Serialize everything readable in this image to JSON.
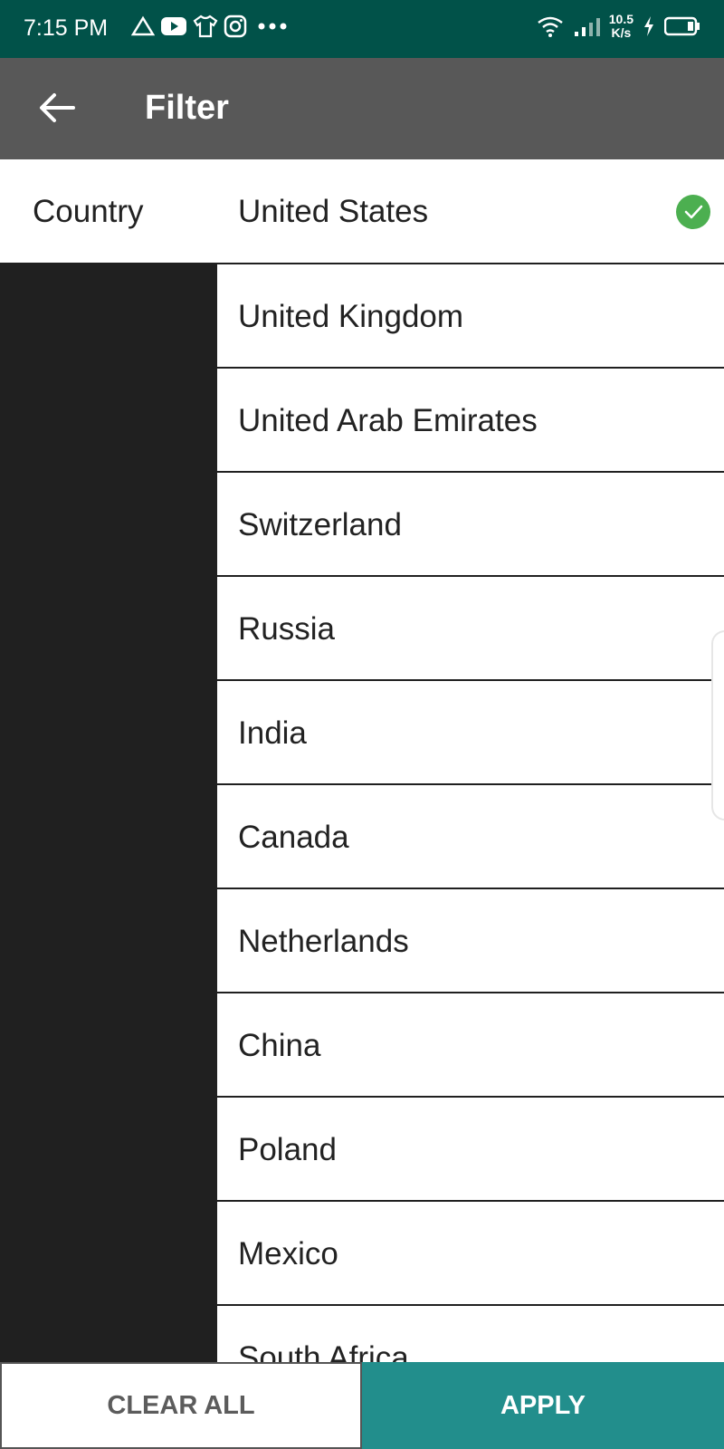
{
  "status_bar": {
    "time": "7:15 PM",
    "network_speed": "10.5",
    "network_speed_unit": "K/s",
    "icons_left": [
      "triangle-icon",
      "youtube-icon",
      "shirt-icon",
      "instagram-icon",
      "more-dots-icon"
    ],
    "icons_right": [
      "wifi-icon",
      "signal-icon",
      "charging-icon",
      "battery-icon"
    ]
  },
  "app_bar": {
    "title": "Filter"
  },
  "filter": {
    "label": "Country",
    "selected": "United States",
    "accent": "#4caf50"
  },
  "countries": [
    "United Kingdom",
    "United Arab Emirates",
    "Switzerland",
    "Russia",
    "India",
    "Canada",
    "Netherlands",
    "China",
    "Poland",
    "Mexico",
    "South Africa"
  ],
  "buttons": {
    "clear": "CLEAR ALL",
    "apply": "APPLY"
  },
  "colors": {
    "status_bar": "#015249",
    "app_bar": "#585858",
    "apply": "#228e8c"
  }
}
